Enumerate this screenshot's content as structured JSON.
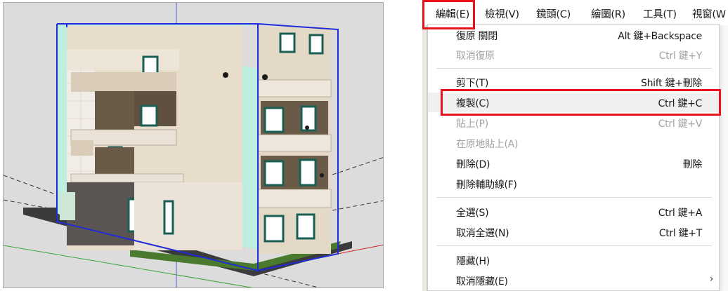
{
  "menubar": {
    "items": [
      {
        "label": "編輯(E)"
      },
      {
        "label": "檢視(V)"
      },
      {
        "label": "鏡頭(C)"
      },
      {
        "label": "繪圖(R)"
      },
      {
        "label": "工具(T)"
      },
      {
        "label": "視窗(W"
      }
    ]
  },
  "edit_menu": {
    "items": [
      {
        "label": "復原 關閉",
        "shortcut": "Alt 鍵+Backspace",
        "enabled": true
      },
      {
        "label": "取消復原",
        "shortcut": "Ctrl 鍵+Y",
        "enabled": false
      },
      {
        "label": "剪下(T)",
        "shortcut": "Shift 鍵+刪除",
        "enabled": true
      },
      {
        "label": "複製(C)",
        "shortcut": "Ctrl 鍵+C",
        "enabled": true,
        "highlighted": true
      },
      {
        "label": "貼上(P)",
        "shortcut": "Ctrl 鍵+V",
        "enabled": false
      },
      {
        "label": "在原地貼上(A)",
        "shortcut": "",
        "enabled": false
      },
      {
        "label": "刪除(D)",
        "shortcut": "刪除",
        "enabled": true
      },
      {
        "label": "刪除輔助線(F)",
        "shortcut": "",
        "enabled": true
      },
      {
        "label": "全選(S)",
        "shortcut": "Ctrl 鍵+A",
        "enabled": true
      },
      {
        "label": "取消全選(N)",
        "shortcut": "Ctrl 鍵+T",
        "enabled": true
      },
      {
        "label": "隱藏(H)",
        "shortcut": "",
        "enabled": true
      },
      {
        "label": "取消隱藏(E)",
        "shortcut": "",
        "enabled": true,
        "submenu_icon": "chevron-right-icon"
      }
    ]
  },
  "colors": {
    "highlight_box": "#e8141b",
    "selection_outline": "#1f2bd6",
    "axis_blue": "#4a5fd0",
    "axis_green": "#3aa43a",
    "axis_red": "#cc2222",
    "facade_beige": "#e8dccb",
    "glass_cyan": "#bdeee0"
  }
}
